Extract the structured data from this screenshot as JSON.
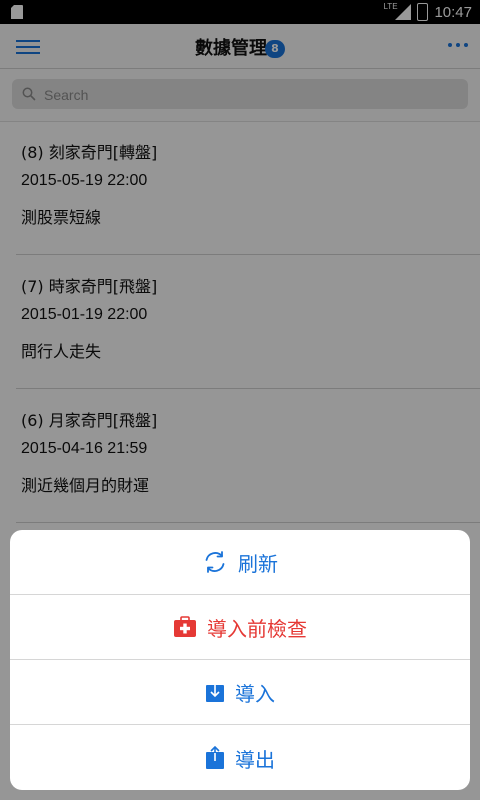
{
  "status": {
    "network": "LTE",
    "time": "10:47"
  },
  "nav": {
    "title": "數據管理",
    "badge": "8"
  },
  "search": {
    "placeholder": "Search"
  },
  "records": [
    {
      "title": "(8) 刻家奇門[轉盤]",
      "date": "2015-05-19 22:00",
      "question": "測股票短線"
    },
    {
      "title": "(7) 時家奇門[飛盤]",
      "date": "2015-01-19 22:00",
      "question": "問行人走失"
    },
    {
      "title": "(6) 月家奇門[飛盤]",
      "date": "2015-04-16 21:59",
      "question": "測近幾個月的財運"
    }
  ],
  "actions": [
    {
      "label": "刷新",
      "icon": "refresh-icon"
    },
    {
      "label": "導入前檢查",
      "icon": "first-aid-kit-icon"
    },
    {
      "label": "導入",
      "icon": "import-icon"
    },
    {
      "label": "導出",
      "icon": "export-icon"
    }
  ],
  "colors": {
    "accent": "#1a73d9",
    "danger": "#e53935"
  }
}
